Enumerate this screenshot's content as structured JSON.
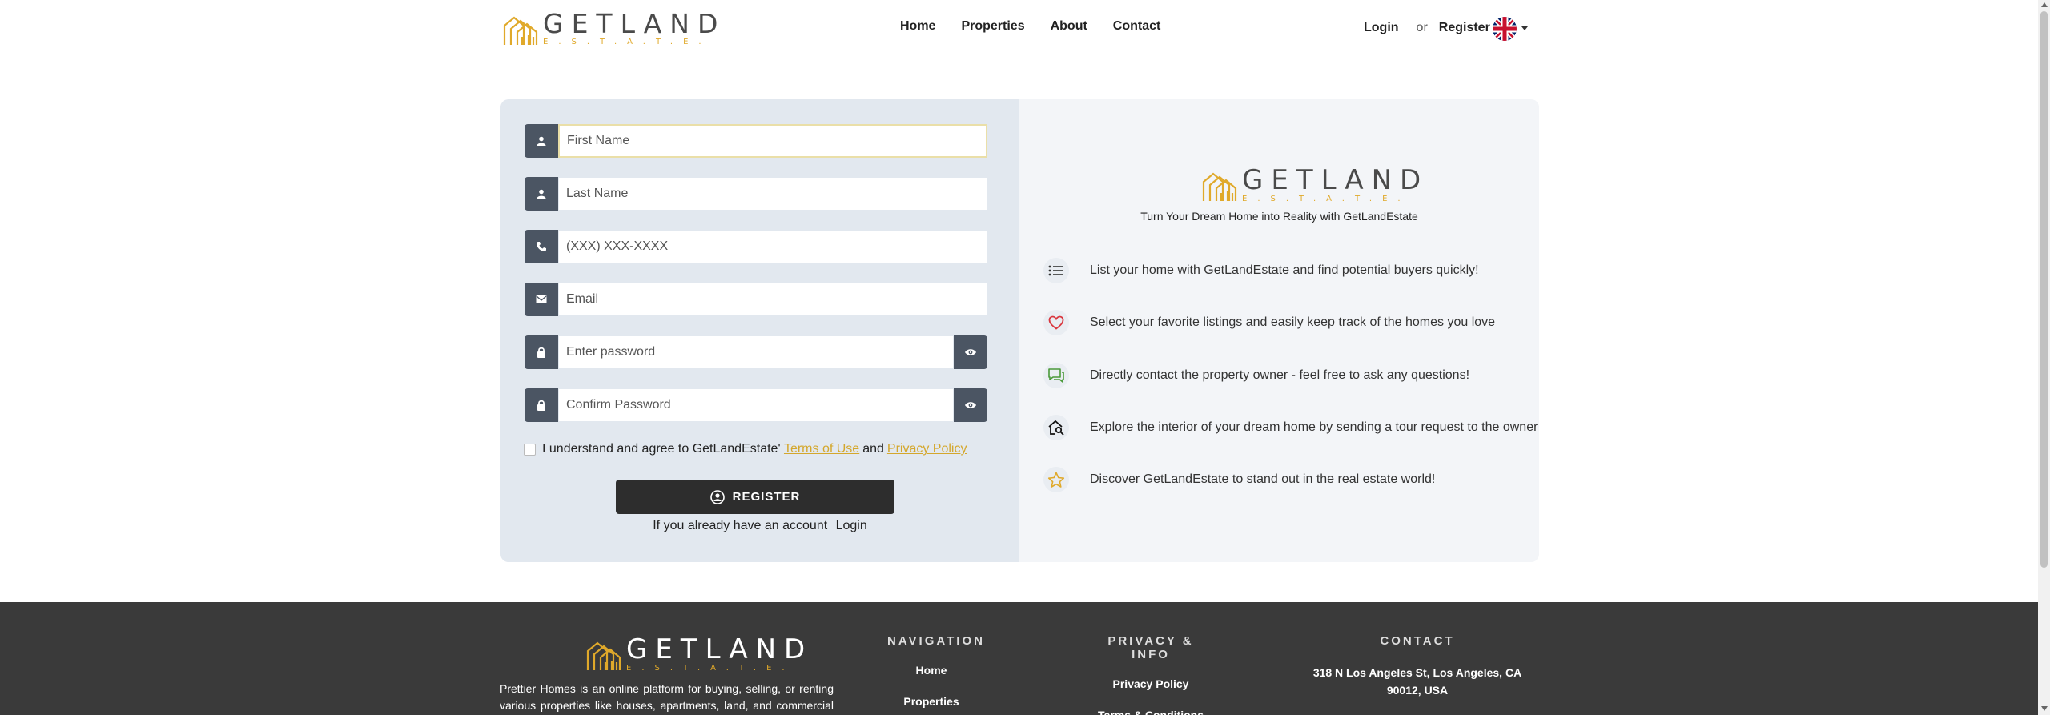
{
  "header": {
    "logo": {
      "main": "GETLAND",
      "sub": "E.S.T.A.T.E."
    },
    "nav": [
      "Home",
      "Properties",
      "About",
      "Contact"
    ],
    "login_label": "Login",
    "or_label": "or",
    "register_label": "Register",
    "language_icon": "uk-flag-icon"
  },
  "form": {
    "fields": {
      "first_name_placeholder": "First Name",
      "last_name_placeholder": "Last Name",
      "phone_placeholder": "(XXX) XXX-XXXX",
      "email_placeholder": "Email",
      "password_placeholder": "Enter password",
      "confirm_password_placeholder": "Confirm Password"
    },
    "agree_text": "I understand and agree to GetLandEstate'",
    "terms_label": "Terms of Use",
    "and_label": "and",
    "privacy_label": "Privacy Policy",
    "register_button": "REGISTER",
    "already_text": "If you already have an account",
    "login_link": "Login",
    "accent_color": "#d4a72c",
    "button_color": "#2d2d2d"
  },
  "promo": {
    "logo": {
      "main": "GETLAND",
      "sub": "E.S.T.A.T.E."
    },
    "tagline": "Turn Your Dream Home into Reality with GetLandEstate",
    "features": [
      {
        "icon": "list-icon",
        "text": "List your home with GetLandEstate and find potential buyers quickly!"
      },
      {
        "icon": "heart-icon",
        "text": "Select your favorite listings and easily keep track of the homes you love"
      },
      {
        "icon": "chat-icon",
        "text": "Directly contact the property owner - feel free to ask any questions!"
      },
      {
        "icon": "home-search-icon",
        "text": "Explore the interior of your dream home by sending a tour request to the owner"
      },
      {
        "icon": "star-icon",
        "text": "Discover GetLandEstate to stand out in the real estate world!"
      }
    ]
  },
  "footer": {
    "logo": {
      "main": "GETLAND",
      "sub": "E.S.T.A.T.E."
    },
    "about": "Prettier Homes is an online platform for buying, selling, or renting various properties like houses, apartments, land, and commercial real estate. It",
    "navigation": {
      "title": "NAVIGATION",
      "links": [
        "Home",
        "Properties"
      ]
    },
    "privacy": {
      "title": "PRIVACY & INFO",
      "links": [
        "Privacy Policy",
        "Terms & Conditions"
      ]
    },
    "contact": {
      "title": "CONTACT",
      "address": "318 N Los Angeles St, Los Angeles, CA 90012, USA"
    }
  }
}
